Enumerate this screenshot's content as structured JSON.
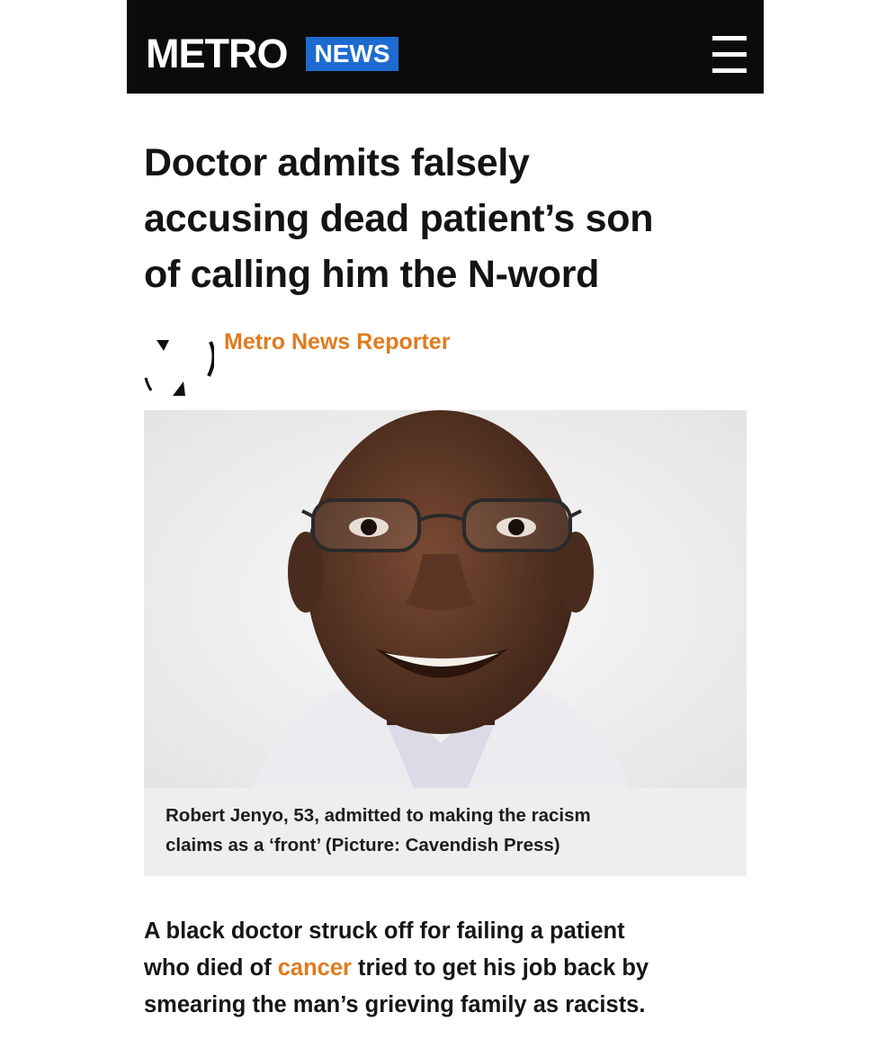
{
  "header": {
    "logo_text": "METRO",
    "section_badge": "NEWS",
    "menu_icon": "hamburger-menu-icon",
    "colors": {
      "bar": "#0b0b0b",
      "badge": "#1d6bd1"
    }
  },
  "article": {
    "headline_line1": "Doctor admits falsely",
    "headline_line2": "accusing dead patient’s son",
    "headline_line3": "of calling him the N-word",
    "author": "Metro News Reporter",
    "author_icon": "metro-author-logo-icon",
    "image_caption_line1": "Robert Jenyo, 53, admitted to making the racism",
    "image_caption_line2": "claims as a ‘front’ (Picture: Cavendish Press)",
    "lead_part1": "A black doctor struck off for failing a patient",
    "lead_part2": "who died of ",
    "lead_link": "cancer",
    "lead_part3": " tried to get his job back by",
    "lead_part4": "smearing the man’s grieving family as racists.",
    "accent_color": "#e07b1f"
  }
}
